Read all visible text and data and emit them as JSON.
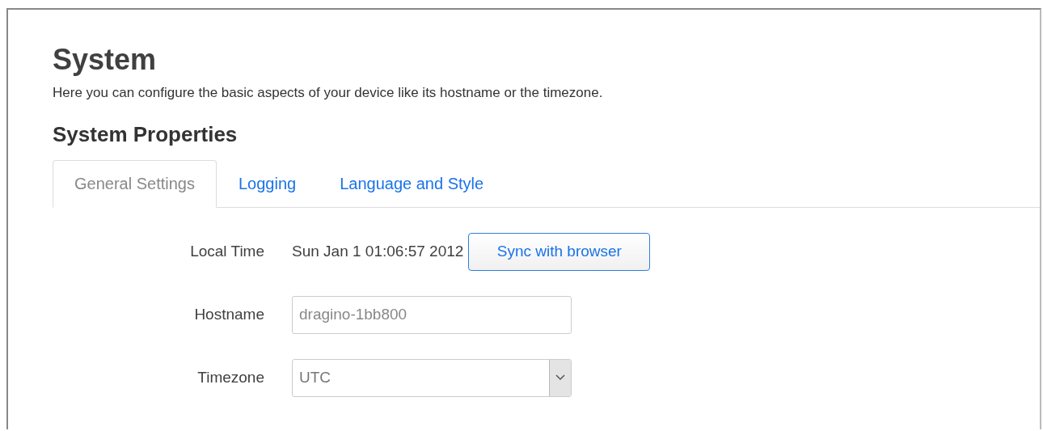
{
  "page": {
    "title": "System",
    "description": "Here you can configure the basic aspects of your device like its hostname or the timezone."
  },
  "section": {
    "title": "System Properties"
  },
  "tabs": [
    {
      "label": "General Settings",
      "selected": true
    },
    {
      "label": "Logging",
      "selected": false
    },
    {
      "label": "Language and Style",
      "selected": false
    }
  ],
  "fields": [
    {
      "kind": "text",
      "label": "Local Time",
      "value": "Sun Jan 1 01:06:57 2012",
      "button": "Sync with browser"
    },
    {
      "kind": "input",
      "label": "Hostname",
      "placeholder": "dragino-1bb800"
    },
    {
      "kind": "select",
      "label": "Timezone",
      "value": "UTC"
    }
  ]
}
